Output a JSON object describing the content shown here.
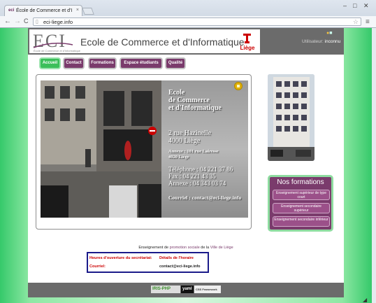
{
  "browser": {
    "tab_title": "École de Commerce et d'I",
    "tab_close": "×",
    "url": "eci-liege.info",
    "win_min": "–",
    "win_max": "□",
    "win_close": "✕",
    "back": "←",
    "forward": "→",
    "reload": "C",
    "star": "☆",
    "menu": "≡"
  },
  "header": {
    "logo_text": "ECI",
    "logo_subtext": "École de Commerce et d'Informatique",
    "school_name": "Ecole de Commerce et d'Informatique",
    "liege_text": "Liège",
    "user_prefix": "Utilisateur: ",
    "user_name": "inconnu"
  },
  "menu": {
    "items": [
      {
        "label": "Accueil",
        "active": true
      },
      {
        "label": "Contact",
        "active": false
      },
      {
        "label": "Formations",
        "active": false
      },
      {
        "label": "Espace étudiants",
        "active": false
      },
      {
        "label": "Qualité",
        "active": false
      }
    ]
  },
  "info": {
    "name_line1": "Ecole",
    "name_line2": "de Commerce",
    "name_line3": "et d'Informatique",
    "street": "2 rue Hazinelle",
    "city": "4000 Liège",
    "annex_line1": "Annexe : 101 rue Lairesse",
    "annex_line2": "4020 Liège",
    "phone": "Téléphone : 04 221 37 86",
    "fax": "Fax :  04 221 43 35",
    "annex_phone": "Annexe :  04 343 03 74",
    "email": "Courriel : contact@eci-liege.info"
  },
  "formations": {
    "title": "Nos formations",
    "items": [
      "Enseignement supérieur de type court",
      "Enseignement secondaire supérieur",
      "Enseignement secondaire inférieur"
    ]
  },
  "promo": {
    "prefix": "Enseignement de ",
    "link1": "promotion sociale",
    "middle": " de la ",
    "link2": "Ville de Liège"
  },
  "hours": {
    "label1": "Heures d'ouverture du secrétariat:",
    "value1": "Détails de l'horaire",
    "label2": "Courriel:",
    "value2": "contact@eci-liege.info"
  },
  "footer": {
    "badge1": "IRIS-PHP",
    "badge2": "yaml",
    "badge3": "CSS Framework"
  },
  "colors": {
    "accent": "#7a3b6c",
    "green": "#3bbf5a",
    "header_gray": "#6b6b6b"
  }
}
